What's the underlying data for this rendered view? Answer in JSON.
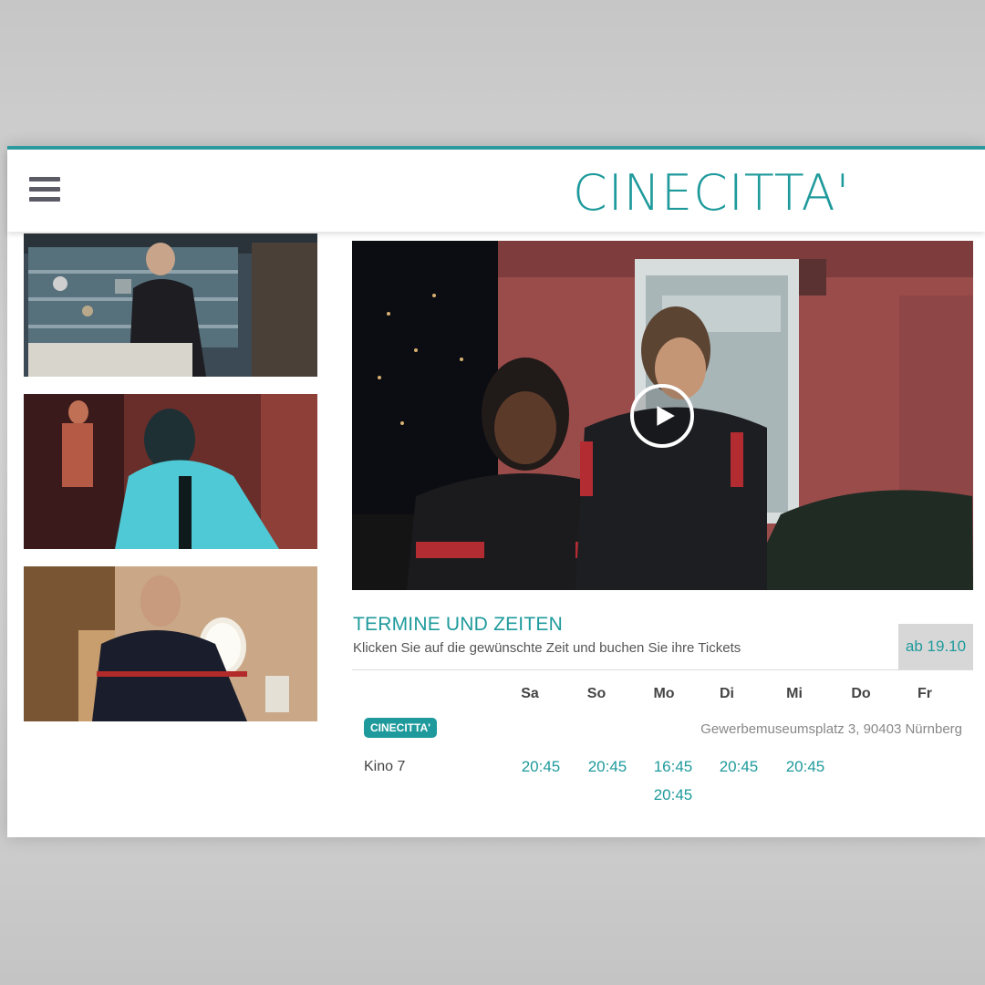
{
  "header": {
    "logo_text": "CINECITTA'",
    "menu_icon": "hamburger-menu-icon",
    "accent_color": "#2a9a9e"
  },
  "media": {
    "play_icon": "play-icon"
  },
  "schedule": {
    "title": "TERMINE UND ZEITEN",
    "subtitle": "Klicken Sie auf die gewünschte Zeit und buchen Sie ihre Tickets",
    "from_date": "ab 19.10",
    "days": [
      "Sa",
      "So",
      "Mo",
      "Di",
      "Mi",
      "Do",
      "Fr"
    ],
    "cinema_badge": "CINECITTA'",
    "address": "Gewerbemuseumsplatz 3, 90403 Nürnberg",
    "hall": "Kino 7",
    "times": {
      "sa": [
        "20:45"
      ],
      "so": [
        "20:45"
      ],
      "mo": [
        "16:45",
        "20:45"
      ],
      "di": [
        "20:45"
      ],
      "mi": [
        "20:45"
      ]
    }
  }
}
